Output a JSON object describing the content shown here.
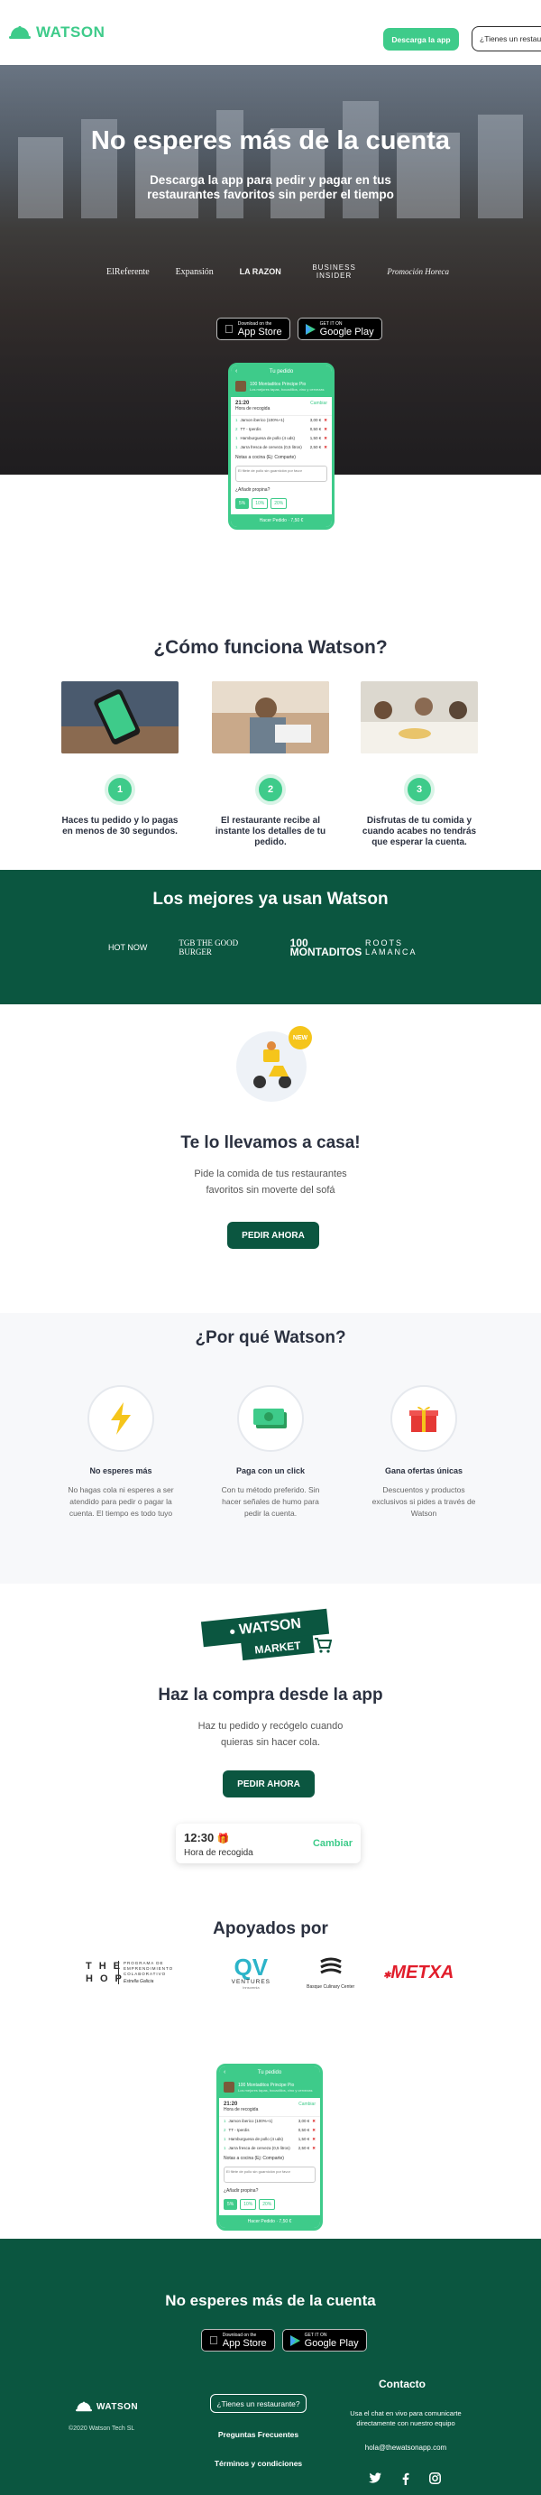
{
  "header": {
    "logo_text": "WATSON",
    "download_button": "Descarga la app",
    "restaurant_button": "¿Tienes un restaurante?"
  },
  "hero": {
    "title": "No esperes más de la cuenta",
    "subtitle": "Descarga la app para pedir y pagar en tus restaurantes favoritos sin perder el tiempo",
    "press": [
      "ElReferente",
      "Expansión",
      "LA RAZON",
      "BUSINESS INSIDER",
      "Promoción Horeca"
    ],
    "app_store": {
      "small": "Download on the",
      "big": "App Store"
    },
    "google_play": {
      "small": "GET IT ON",
      "big": "Google Play"
    }
  },
  "phone": {
    "header": "Tu pedido",
    "restaurant": "100 Montaditos Principe Pio",
    "restaurant_sub": "Los mejores tapas, bocadillos, vino y cervezas",
    "time": "21:20",
    "time_label": "Hora de recogida",
    "change": "Cambiar",
    "items": [
      {
        "qty": "1",
        "name": "Jamon iberico (100%+1)",
        "price": "3,00 €"
      },
      {
        "qty": "2",
        "name": "TT - Iperdis",
        "price": "0,50 €"
      },
      {
        "qty": "1",
        "name": "Hamburguesa de pollo (4 uds)",
        "price": "1,50 €"
      },
      {
        "qty": "1",
        "name": "Jarra fresca de cerveza (0,5 litros)",
        "price": "2,50 €"
      }
    ],
    "note_label": "Notas a cocina (Ej: Comparte)",
    "note_text": "El filete de pollo sin guarnición por favor",
    "tip_question": "¿Añadir propina?",
    "tips": [
      "5%",
      "10%",
      "20%"
    ],
    "pay_label": "Hacer Pedido · 7,50 €"
  },
  "how": {
    "title": "¿Cómo funciona Watson?",
    "steps": [
      {
        "num": "1",
        "text": "Haces tu pedido y lo pagas en menos de 30 segundos."
      },
      {
        "num": "2",
        "text": "El restaurante recibe al instante los detalles de tu pedido."
      },
      {
        "num": "3",
        "text": "Disfrutas de tu comida y cuando acabes no tendrás que esperar la cuenta."
      }
    ]
  },
  "best": {
    "title": "Los mejores ya usan Watson",
    "logos": [
      "HOT NOW",
      "TGB THE GOOD BURGER",
      "100 MONTADITOS",
      "ROOTS LAMANCA"
    ]
  },
  "delivery": {
    "badge": "NEW",
    "title": "Te lo llevamos a casa!",
    "subtitle": "Pide la comida de tus restaurantes favoritos sin moverte del sofá",
    "button": "PEDIR AHORA"
  },
  "why": {
    "title": "¿Por qué Watson?",
    "items": [
      {
        "title": "No esperes más",
        "text": "No hagas cola ni esperes a ser atendido para pedir o pagar la cuenta. El tiempo es todo tuyo"
      },
      {
        "title": "Paga con un click",
        "text": "Con tu método preferido. Sin hacer señales de humo para pedir la cuenta."
      },
      {
        "title": "Gana ofertas únicas",
        "text": "Descuentos y productos exclusivos si pides a través de Watson"
      }
    ]
  },
  "market": {
    "logo_top": "WATSON",
    "logo_bottom": "MARKET",
    "title": "Haz la compra desde la app",
    "subtitle": "Haz tu pedido y recógelo cuando quieras sin hacer cola.",
    "button": "PEDIR AHORA",
    "pickup_time": "12:30",
    "pickup_label": "Hora de recogida",
    "pickup_change": "Cambiar"
  },
  "supported": {
    "title": "Apoyados por",
    "logos": {
      "thehop": "THE HOP",
      "thehop_sub": "PROGRAMA DE EMPRENDIMIENTO COLABORATIVO",
      "thehop_brand": "Estrella Galicia",
      "ventures": "VENTURES",
      "ventures_sub": "Innsomnia",
      "basque": "Basque Culinary Center",
      "metxa": "METXA"
    }
  },
  "footer": {
    "title": "No esperes más de la cuenta",
    "logo_text": "WATSON",
    "copyright": "©2020 Watson Tech SL",
    "restaurant_button": "¿Tienes un restaurante?",
    "faq": "Preguntas Frecuentes",
    "terms": "Términos y condiciones",
    "contact_title": "Contacto",
    "contact_text": "Usa el chat en vivo para comunicarte directamente con nuestro equipo",
    "email": "hola@thewatsonapp.com"
  },
  "colors": {
    "brand_green": "#3ecb8a",
    "dark_green": "#0b5640"
  }
}
